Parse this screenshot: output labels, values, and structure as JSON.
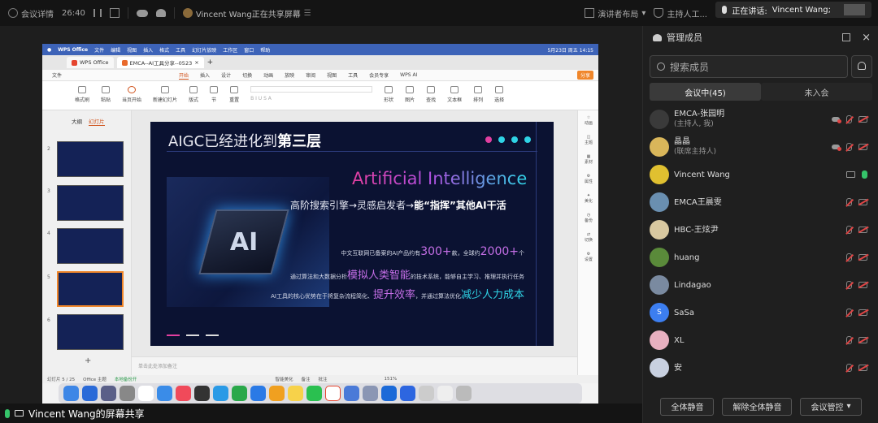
{
  "topbar": {
    "meeting_info": "会议详情",
    "duration": "26:40",
    "sharing_status": "Vincent Wang正在共享屏幕",
    "presenter_layout": "演讲者布局",
    "host_tools": "主持人工...",
    "speaking_label": "正在讲话:",
    "speaking_name": "Vincent Wang;"
  },
  "wps": {
    "menubar": [
      "WPS Office",
      "文件",
      "编辑",
      "视图",
      "插入",
      "格式",
      "工具",
      "幻灯片放映",
      "工作区",
      "窗口",
      "帮助"
    ],
    "clock": "5月23日 周五 14:15",
    "tabs": [
      "WPS Office",
      "EMCA--AI工具分享--0523"
    ],
    "ribbon_tabs": [
      "文件",
      "开始",
      "插入",
      "设计",
      "切换",
      "动画",
      "放映",
      "审阅",
      "视图",
      "工具",
      "会员专享",
      "WPS AI"
    ],
    "ribbon_active": "开始",
    "share_btn": "分享",
    "ribbon_buttons": [
      "格式刷",
      "粘贴",
      "当页开始",
      "新建幻灯片",
      "版式",
      "节",
      "重置",
      "形状",
      "图片",
      "查找",
      "文本框",
      "排列",
      "选择"
    ],
    "panel_tabs": [
      "大纲",
      "幻灯片"
    ],
    "thumb_numbers": [
      "2",
      "3",
      "4",
      "5",
      "6"
    ],
    "right_tools": [
      "动画",
      "主题",
      "素材",
      "属性",
      "美化",
      "备份",
      "切换",
      "设置"
    ],
    "notes_placeholder": "单击此处添加备注",
    "status": {
      "slide": "幻灯片 5 / 25",
      "theme": "Office 主题",
      "backup": "本地备份开",
      "beautify": "智能美化",
      "notes": "备注",
      "comments": "批注",
      "zoom": "151%"
    }
  },
  "slide": {
    "title_prefix": "AIGC已经进化到",
    "title_bold": "第三层",
    "ai_title": "Artificial Intelligence",
    "subtitle_prefix": "高阶搜索引擎→灵感启发者→",
    "subtitle_bold": "能“指挥”其他AI干活",
    "line1_a": "中文互联网已备案的AI产品约有",
    "line1_num1": "300+",
    "line1_b": "款，全球约",
    "line1_num2": "2000+",
    "line1_c": "个",
    "line2_a": "通过算法和大数据分析",
    "line2_hl": "模拟人类智能",
    "line2_b": "的技术系统，能够自主学习、推理并执行任务",
    "line3_a": "AI工具的核心优势在于将复杂流程简化、",
    "line3_hl1": "提升效率",
    "line3_b": "，并通过算法优化",
    "line3_hl2": "减少人力成本",
    "chip_text": "AI"
  },
  "share_label": "Vincent Wang的屏幕共享",
  "panel": {
    "title": "管理成员",
    "search_placeholder": "搜索成员",
    "tab_in": "会议中(45)",
    "tab_out": "未入会",
    "members": [
      {
        "name": "EMCA-张园明",
        "sub": "(主持人, 我)",
        "avatar": "photo"
      },
      {
        "name": "晶晶",
        "sub": "(联席主持人)",
        "avatar": "photo"
      },
      {
        "name": "Vincent Wang",
        "sub": "",
        "avatar": "photo"
      },
      {
        "name": "EMCA王晨雯",
        "sub": "",
        "avatar": "photo"
      },
      {
        "name": "HBC-王炫尹",
        "sub": "",
        "avatar": "photo"
      },
      {
        "name": "huang",
        "sub": "",
        "avatar": "photo"
      },
      {
        "name": "Lindagao",
        "sub": "",
        "avatar": "photo"
      },
      {
        "name": "SaSa",
        "sub": "",
        "avatar": "S"
      },
      {
        "name": "XL",
        "sub": "",
        "avatar": "photo"
      },
      {
        "name": "安",
        "sub": "",
        "avatar": "photo"
      }
    ],
    "footer": {
      "mute_all": "全体静音",
      "unmute_all": "解除全体静音",
      "controls": "会议管控"
    }
  },
  "colors": {
    "accent": "#3c7ef0",
    "slide_bg": "#0b1232",
    "pink": "#e23fa0",
    "cyan": "#2fd4e6"
  }
}
